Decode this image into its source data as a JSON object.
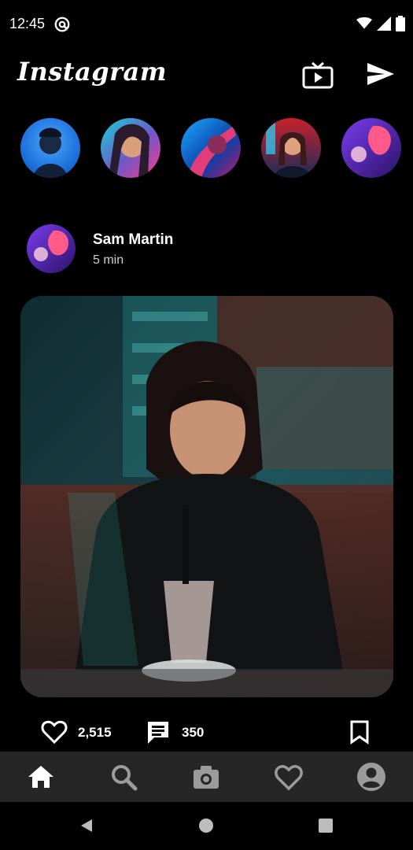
{
  "status_bar": {
    "time": "12:45"
  },
  "header": {
    "logo": "Instagram",
    "icons": [
      "igtv-icon",
      "send-icon"
    ]
  },
  "stories": [
    {
      "icon": "story-avatar-1"
    },
    {
      "icon": "story-avatar-2"
    },
    {
      "icon": "story-avatar-3"
    },
    {
      "icon": "story-avatar-4"
    },
    {
      "icon": "story-avatar-5"
    }
  ],
  "post": {
    "username": "Sam Martin",
    "time": "5 min",
    "likes": "2,515",
    "comments": "350"
  },
  "bottom_nav": {
    "items": [
      "home-icon",
      "search-icon",
      "camera-icon",
      "heart-icon",
      "profile-icon"
    ]
  },
  "system_nav": {
    "items": [
      "back-icon",
      "home-circle-icon",
      "recents-icon"
    ]
  }
}
